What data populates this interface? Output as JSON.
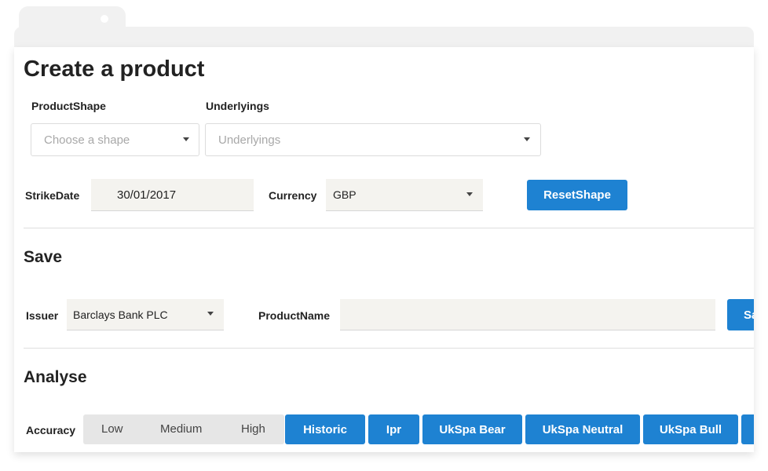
{
  "page": {
    "title": "Create a product"
  },
  "product_shape": {
    "label": "ProductShape",
    "placeholder": "Choose a shape"
  },
  "underlyings": {
    "label": "Underlyings",
    "placeholder": "Underlyings"
  },
  "strike_date": {
    "label": "StrikeDate",
    "value": "30/01/2017"
  },
  "currency": {
    "label": "Currency",
    "value": "GBP"
  },
  "reset_shape_button": {
    "label": "ResetShape"
  },
  "save_section": {
    "title": "Save",
    "issuer": {
      "label": "Issuer",
      "value": "Barclays Bank PLC"
    },
    "product_name": {
      "label": "ProductName",
      "value": ""
    },
    "save_button": {
      "label": "Sa"
    }
  },
  "analyse_section": {
    "title": "Analyse",
    "accuracy": {
      "label": "Accuracy",
      "options": [
        "Low",
        "Medium",
        "High"
      ]
    },
    "buttons": [
      "Historic",
      "Ipr",
      "UkSpa Bear",
      "UkSpa Neutral",
      "UkSpa Bull"
    ]
  },
  "colors": {
    "primary": "#1e82d2",
    "field_bg": "#f4f3ef",
    "segment_bg": "#e6e6e6"
  }
}
